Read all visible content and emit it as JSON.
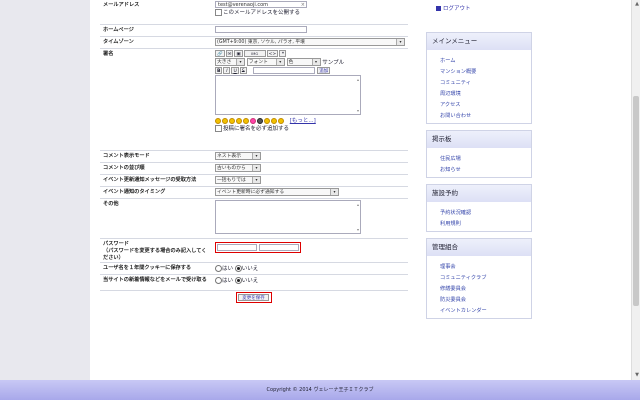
{
  "form": {
    "email": {
      "label": "メールアドレス",
      "value": "test@verenaoji.com",
      "clear": "×",
      "publish_label": "このメールアドレスを公開する"
    },
    "homepage": {
      "label": "ホームページ",
      "value": ""
    },
    "timezone": {
      "label": "タイムゾーン",
      "value": "(GMT+9:00) 東京, ソウル, パラオ, 平壌"
    },
    "signature": {
      "label": "署名",
      "size": "大きさ",
      "font": "フォント",
      "color": "色",
      "sample": "サンプル",
      "bold": "B",
      "italic": "I",
      "underline": "U",
      "strike": "S",
      "add_button": "追加",
      "more_link": "[もっと...]",
      "always_label": "投稿に署名を必ず追加する"
    },
    "comment_mode": {
      "label": "コメント表示モード",
      "value": "ネスト表示"
    },
    "comment_order": {
      "label": "コメントの並び順",
      "value": "古いものから"
    },
    "event_msg": {
      "label": "イベント更新通知メッセージの受取方法",
      "value": "一括もりでは"
    },
    "event_timing": {
      "label": "イベント通知のタイミング",
      "value": "イベント更新時に必ず通知する"
    },
    "other": {
      "label": "その他"
    },
    "password": {
      "label": "パスワード",
      "note": "（パスワードを変更する場合のみ記入してください）"
    },
    "cookie": {
      "label": "ユーザ名を１年間クッキーに保存する",
      "yes": "はい",
      "no": "いいえ"
    },
    "newinfo": {
      "label": "当サイトの新着情報などをメールで受け取る",
      "yes": "はい",
      "no": "いいえ"
    },
    "submit": "変更を保存"
  },
  "sidebar": {
    "top_links": [
      "ログアウト"
    ],
    "menus": [
      {
        "title": "メインメニュー",
        "items": [
          "ホーム",
          "マンション概要",
          "コミュニティ",
          "周辺環境",
          "アクセス",
          "お問い合わせ"
        ]
      },
      {
        "title": "掲示板",
        "items": [
          "住民広場",
          "お知らせ"
        ]
      },
      {
        "title": "施設予約",
        "items": [
          "予約状況確認",
          "利用規則"
        ]
      },
      {
        "title": "管理組合",
        "items": [
          "理事会",
          "コミュニティクラブ",
          "修繕委員会",
          "防災委員会",
          "イベントカレンダー"
        ]
      }
    ]
  },
  "footer": "Copyright © 2014 ヴェレーナ王子ＩＴクラブ",
  "colors": {
    "accent": "#3344aa",
    "footer": "#b0b0ee",
    "highlight": "#dd0000"
  }
}
